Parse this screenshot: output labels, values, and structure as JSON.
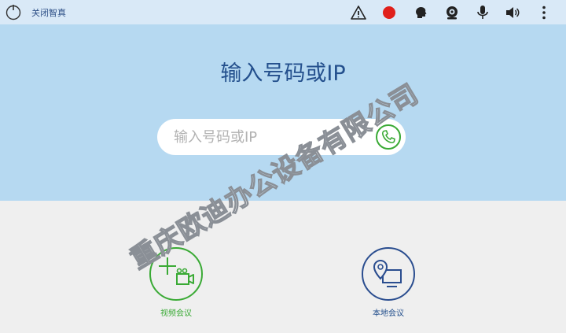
{
  "topbar": {
    "close_label": "关闭智真",
    "icons": [
      "power-icon",
      "warning-icon",
      "record-icon",
      "speaker-head-icon",
      "camera-icon",
      "microphone-icon",
      "volume-icon",
      "more-icon"
    ]
  },
  "hero": {
    "title": "输入号码或IP",
    "dial_placeholder": "输入号码或IP",
    "dial_value": ""
  },
  "actions": {
    "video_conference_label": "视频会议",
    "local_conference_label": "本地会议"
  },
  "watermark": {
    "text": "重庆欧迪办公设备有限公司"
  },
  "colors": {
    "topbar_bg": "#d9e9f7",
    "hero_bg": "#b6d9f1",
    "title": "#24508d",
    "green_accent": "#3aaa35",
    "blue_accent": "#2a4d8f",
    "record_red": "#e0201b"
  }
}
